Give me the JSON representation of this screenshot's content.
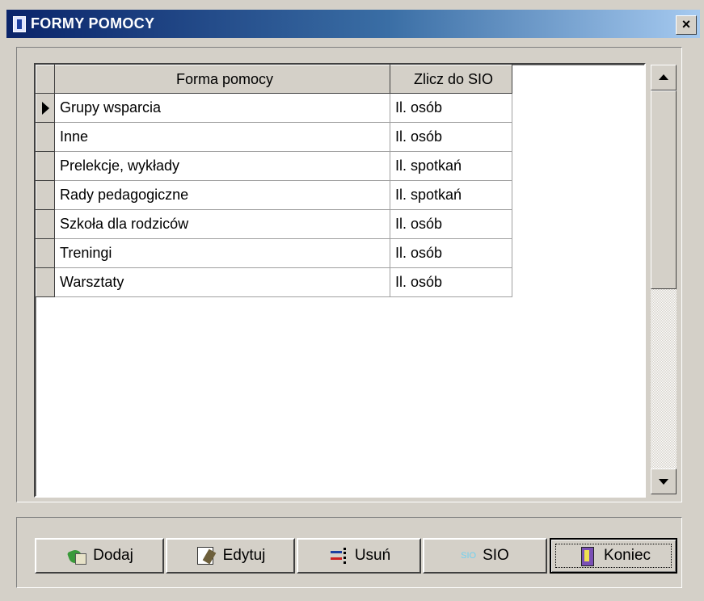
{
  "window": {
    "title": "FORMY POMOCY",
    "close_label": "×",
    "icon": "app-icon"
  },
  "grid": {
    "columns": [
      "Forma pomocy",
      "Zlicz do SIO"
    ],
    "rows": [
      {
        "forma": "Grupy wsparcia",
        "zlicz": "Il. osób",
        "current": true
      },
      {
        "forma": "Inne",
        "zlicz": "Il. osób",
        "current": false
      },
      {
        "forma": "Prelekcje, wykłady",
        "zlicz": "Il. spotkań",
        "current": false
      },
      {
        "forma": "Rady pedagogiczne",
        "zlicz": "Il. spotkań",
        "current": false
      },
      {
        "forma": "Szkoła dla rodziców",
        "zlicz": "Il. osób",
        "current": false
      },
      {
        "forma": "Treningi",
        "zlicz": "Il. osób",
        "current": false
      },
      {
        "forma": "Warsztaty",
        "zlicz": "Il. osób",
        "current": false
      }
    ]
  },
  "buttons": {
    "dodaj": "Dodaj",
    "edytuj": "Edytuj",
    "usun": "Usuń",
    "sio_badge": "SIO",
    "sio": "SIO",
    "koniec": "Koniec"
  },
  "colors": {
    "title_start": "#0a246a",
    "title_end": "#a6caf0",
    "face": "#d4d0c8"
  }
}
